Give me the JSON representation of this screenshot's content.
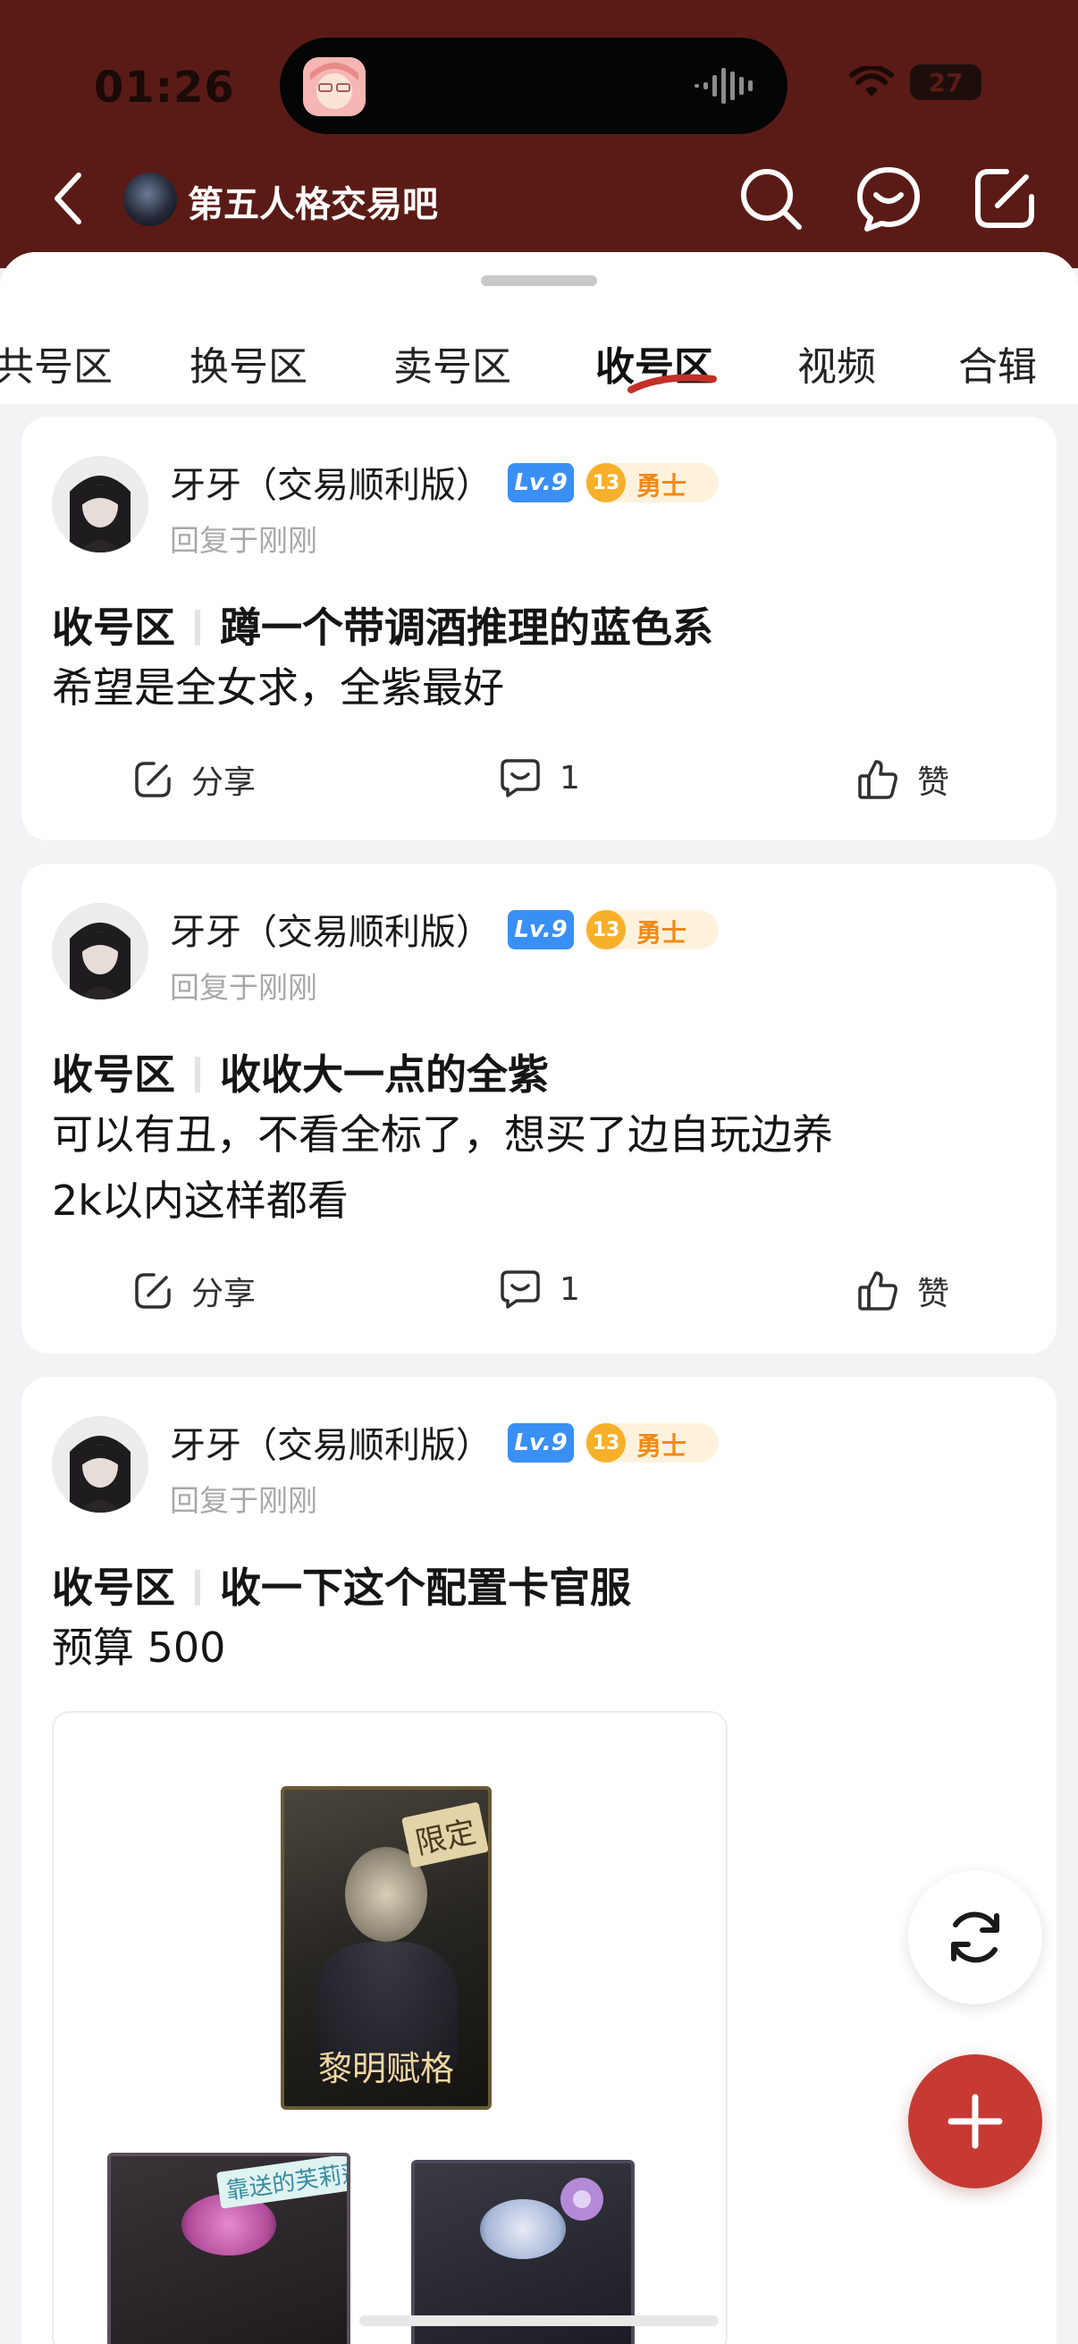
{
  "status_bar": {
    "time": "01:26",
    "battery": "27"
  },
  "header": {
    "title": "第五人格交易吧"
  },
  "tabs": [
    {
      "label": "共号区"
    },
    {
      "label": "换号区"
    },
    {
      "label": "卖号区"
    },
    {
      "label": "收号区",
      "active": true
    },
    {
      "label": "视频"
    },
    {
      "label": "合辑"
    }
  ],
  "posts": [
    {
      "username": "牙牙（交易顺利版）",
      "level": "Lv.9",
      "rank_num": "13",
      "rank_title": "勇士",
      "time": "回复于刚刚",
      "category": "收号区",
      "title": "蹲一个带调酒推理的蓝色系",
      "body": [
        "希望是全女求，全紫最好"
      ],
      "share": "分享",
      "comments": "1",
      "like": "赞"
    },
    {
      "username": "牙牙（交易顺利版）",
      "level": "Lv.9",
      "rank_num": "13",
      "rank_title": "勇士",
      "time": "回复于刚刚",
      "category": "收号区",
      "title": "收收大一点的全紫",
      "body": [
        "可以有丑，不看全标了，想买了边自玩边养",
        "2k以内这样都看"
      ],
      "share": "分享",
      "comments": "1",
      "like": "赞"
    },
    {
      "username": "牙牙（交易顺利版）",
      "level": "Lv.9",
      "rank_num": "13",
      "rank_title": "勇士",
      "time": "回复于刚刚",
      "category": "收号区",
      "title": "收一下这个配置卡官服",
      "body": [
        "预算 500"
      ],
      "image_cards": [
        {
          "name": "黎明赋格",
          "tag": "限定"
        },
        {
          "tag": "靠送的芙莉莲"
        },
        {
          "tag": ""
        }
      ]
    }
  ],
  "colors": {
    "header_bg": "#5a1b16",
    "fab_add": "#c63a33",
    "level_badge": "#3a8ff4",
    "rank_badge": "#f08a16"
  }
}
